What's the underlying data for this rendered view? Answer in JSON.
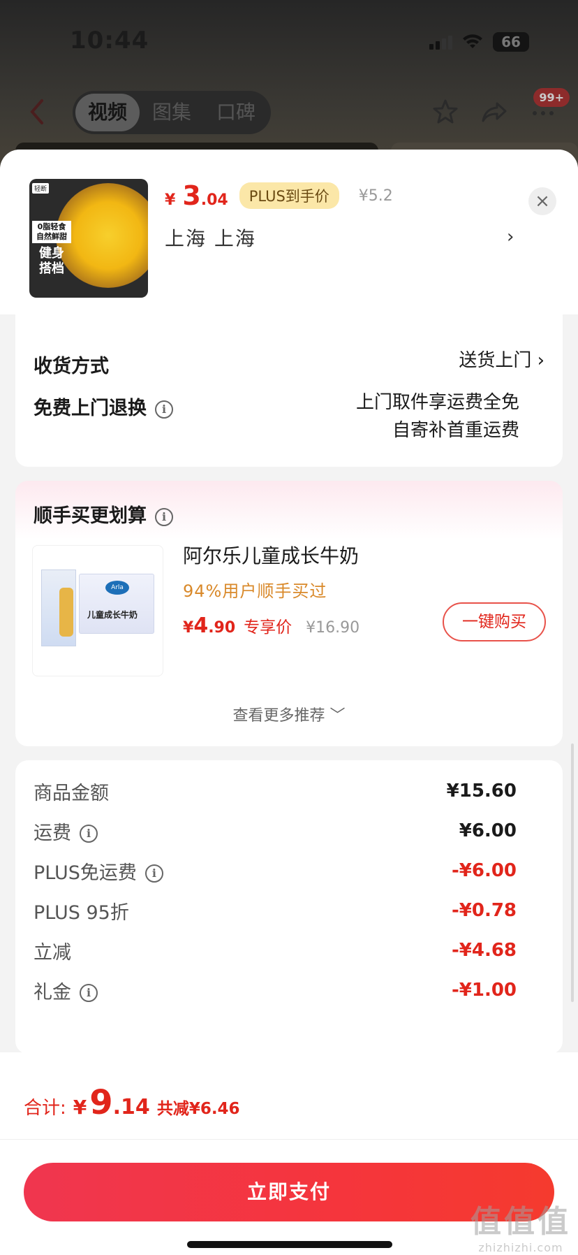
{
  "status_bar": {
    "time": "10:44",
    "battery": "66"
  },
  "nav": {
    "tabs": [
      "视频",
      "图集",
      "口碑"
    ],
    "active_tab": 0,
    "badge": "99+"
  },
  "product": {
    "thumb_tags": {
      "brand": "轻断",
      "line1": "0脂轻食\n自然鲜甜",
      "line2": "健身\n搭档"
    },
    "price_currency": "¥",
    "price_main": "3",
    "price_decimal": ".04",
    "plus_tag": "PLUS到手价",
    "original_price": "¥5.2",
    "address": "上海  上海",
    "chevron": "›",
    "close": "×"
  },
  "delivery": {
    "method_label": "收货方式",
    "method_value": "送货上门 ›",
    "return_label": "免费上门退换",
    "return_line1": "上门取件享运费全免",
    "return_line2": "自寄补首重运费"
  },
  "recommend": {
    "title": "顺手买更划算",
    "item": {
      "name": "阿尔乐儿童成长牛奶",
      "buyers": "94%用户顺手买过",
      "price_currency": "¥",
      "price_main": "4",
      "price_decimal": ".90",
      "price_label": "专享价",
      "original_price": "¥16.90",
      "buy_label": "一键购买",
      "img_logo": "Arla",
      "img_text": "儿童成长牛奶"
    },
    "see_more": "查看更多推荐 ﹀"
  },
  "summary": {
    "rows": [
      {
        "label": "商品金额",
        "value": "¥15.60",
        "info": false,
        "red": false
      },
      {
        "label": "运费",
        "value": "¥6.00",
        "info": true,
        "red": false
      },
      {
        "label": "PLUS免运费",
        "value": "-¥6.00",
        "info": true,
        "red": true
      },
      {
        "label": "PLUS 95折",
        "value": "-¥0.78",
        "info": false,
        "red": true
      },
      {
        "label": "立减",
        "value": "-¥4.68",
        "info": false,
        "red": true
      },
      {
        "label": "礼金",
        "value": "-¥1.00",
        "info": true,
        "red": true
      }
    ]
  },
  "footer": {
    "total_label": "合计:",
    "total_currency": "¥",
    "total_main": "9",
    "total_decimal": ".14",
    "total_saved": "共减¥6.46",
    "pay_label": "立即支付",
    "watermark_big": "值值值",
    "watermark_small": "zhizhizhi.com"
  },
  "colors": {
    "accent": "#e1251b",
    "plus_tag_bg": "#fbe7a8",
    "buyers": "#d9892a"
  }
}
